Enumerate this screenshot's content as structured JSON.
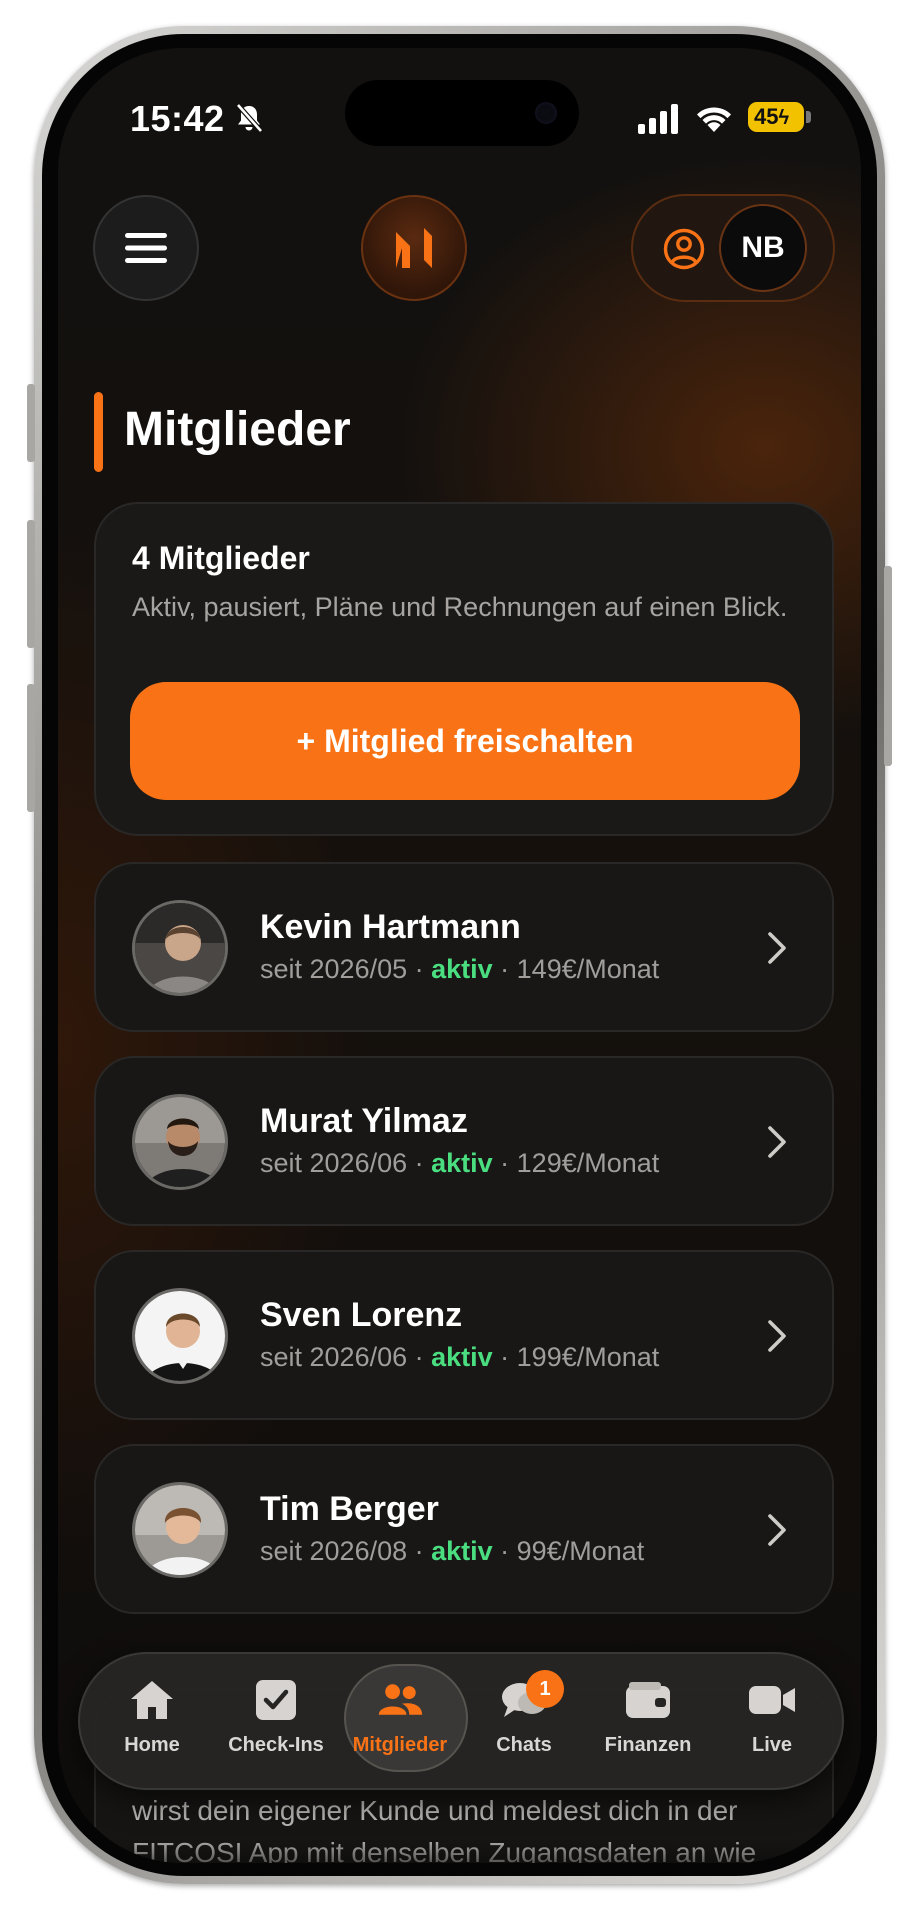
{
  "status_bar": {
    "time": "15:42",
    "battery_level": "45",
    "icons": [
      "bell-slash-icon",
      "cellular-signal-icon",
      "wifi-icon",
      "battery-charging-icon"
    ]
  },
  "header": {
    "menu_icon": "hamburger-menu-icon",
    "logo_icon": "app-logo-icon",
    "account_icon": "user-circle-icon",
    "user_initials": "NB"
  },
  "page": {
    "title": "Mitglieder"
  },
  "summary": {
    "count_label": "4 Mitglieder",
    "description": "Aktiv, pausiert, Pläne und Rechnungen auf einen Blick.",
    "add_button_label": "+ Mitglied freischalten"
  },
  "members": [
    {
      "name": "Kevin Hartmann",
      "since": "seit 2026/05 · ",
      "status": "aktiv",
      "price": " · 149€/Monat"
    },
    {
      "name": "Murat Yilmaz",
      "since": "seit 2026/06 · ",
      "status": "aktiv",
      "price": " · 129€/Monat"
    },
    {
      "name": "Sven Lorenz",
      "since": "seit 2026/06 · ",
      "status": "aktiv",
      "price": " · 199€/Monat"
    },
    {
      "name": "Tim Berger",
      "since": "seit 2026/08 · ",
      "status": "aktiv",
      "price": " · 99€/Monat"
    }
  ],
  "info_peek": {
    "text": "wirst dein eigener Kunde und meldest dich in der FITCOSI App mit denselben Zugangsdaten an wie"
  },
  "tabbar": {
    "tabs": [
      {
        "label": "Home",
        "icon": "home-icon"
      },
      {
        "label": "Check-Ins",
        "icon": "checkbox-icon"
      },
      {
        "label": "Mitglieder",
        "icon": "users-icon",
        "active": true
      },
      {
        "label": "Chats",
        "icon": "chat-bubbles-icon",
        "badge": "1"
      },
      {
        "label": "Finanzen",
        "icon": "wallet-icon"
      },
      {
        "label": "Live",
        "icon": "video-camera-icon"
      }
    ]
  },
  "colors": {
    "accent": "#f97316",
    "status_active": "#4ade80",
    "background": "#121110",
    "card": "#1a1918"
  }
}
